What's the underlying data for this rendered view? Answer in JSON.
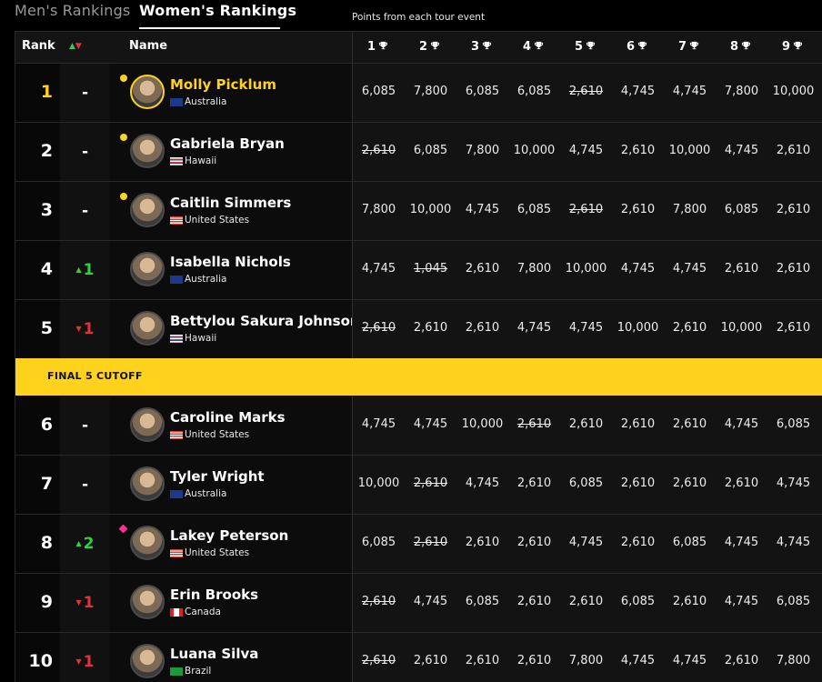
{
  "tabs": {
    "men": "Men's Rankings",
    "women": "Women's Rankings"
  },
  "caption": "Points from each tour event",
  "header": {
    "rank": "Rank",
    "name": "Name",
    "events": [
      "1",
      "2",
      "3",
      "4",
      "5",
      "6",
      "7",
      "8",
      "9"
    ]
  },
  "cutoff_label": "FINAL 5 CUTOFF",
  "colors": {
    "leader": "#ffd21e",
    "up": "#2fd33f",
    "down": "#e0323c",
    "cutoff_band": "#ffd21e"
  },
  "rows": [
    {
      "rank": "1",
      "move": "-",
      "move_dir": "none",
      "name": "Molly Picklum",
      "country": "Australia",
      "flag": "au",
      "leader": true,
      "marker": "yellow-dot",
      "scores": [
        "6,085",
        "7,800",
        "6,085",
        "6,085",
        "2,610",
        "4,745",
        "4,745",
        "7,800",
        "10,000"
      ],
      "dropped": [
        4
      ]
    },
    {
      "rank": "2",
      "move": "-",
      "move_dir": "none",
      "name": "Gabriela Bryan",
      "country": "Hawaii",
      "flag": "hi",
      "leader": false,
      "marker": "yellow-dot",
      "scores": [
        "2,610",
        "6,085",
        "7,800",
        "10,000",
        "4,745",
        "2,610",
        "10,000",
        "4,745",
        "2,610"
      ],
      "dropped": [
        0
      ]
    },
    {
      "rank": "3",
      "move": "-",
      "move_dir": "none",
      "name": "Caitlin Simmers",
      "country": "United States",
      "flag": "us",
      "leader": false,
      "marker": "yellow-dot",
      "scores": [
        "7,800",
        "10,000",
        "4,745",
        "6,085",
        "2,610",
        "2,610",
        "7,800",
        "6,085",
        "2,610"
      ],
      "dropped": [
        4
      ]
    },
    {
      "rank": "4",
      "move": "1",
      "move_dir": "up",
      "name": "Isabella Nichols",
      "country": "Australia",
      "flag": "au",
      "leader": false,
      "marker": "",
      "scores": [
        "4,745",
        "1,045",
        "2,610",
        "7,800",
        "10,000",
        "4,745",
        "4,745",
        "2,610",
        "2,610"
      ],
      "dropped": [
        1
      ]
    },
    {
      "rank": "5",
      "move": "1",
      "move_dir": "down",
      "name": "Bettylou Sakura Johnson",
      "country": "Hawaii",
      "flag": "hi",
      "leader": false,
      "marker": "",
      "scores": [
        "2,610",
        "2,610",
        "2,610",
        "4,745",
        "4,745",
        "10,000",
        "2,610",
        "10,000",
        "2,610"
      ],
      "dropped": [
        0
      ]
    },
    {
      "rank": "6",
      "move": "-",
      "move_dir": "none",
      "name": "Caroline Marks",
      "country": "United States",
      "flag": "us",
      "leader": false,
      "marker": "",
      "scores": [
        "4,745",
        "4,745",
        "10,000",
        "2,610",
        "2,610",
        "2,610",
        "2,610",
        "4,745",
        "6,085"
      ],
      "dropped": [
        3
      ]
    },
    {
      "rank": "7",
      "move": "-",
      "move_dir": "none",
      "name": "Tyler Wright",
      "country": "Australia",
      "flag": "au",
      "leader": false,
      "marker": "",
      "scores": [
        "10,000",
        "2,610",
        "4,745",
        "2,610",
        "6,085",
        "2,610",
        "2,610",
        "2,610",
        "4,745"
      ],
      "dropped": [
        1
      ]
    },
    {
      "rank": "8",
      "move": "2",
      "move_dir": "up",
      "name": "Lakey Peterson",
      "country": "United States",
      "flag": "us",
      "leader": false,
      "marker": "pink-diamond",
      "scores": [
        "6,085",
        "2,610",
        "2,610",
        "2,610",
        "4,745",
        "2,610",
        "6,085",
        "4,745",
        "4,745"
      ],
      "dropped": [
        1
      ]
    },
    {
      "rank": "9",
      "move": "1",
      "move_dir": "down",
      "name": "Erin Brooks",
      "country": "Canada",
      "flag": "ca",
      "leader": false,
      "marker": "",
      "scores": [
        "2,610",
        "4,745",
        "6,085",
        "2,610",
        "2,610",
        "6,085",
        "2,610",
        "4,745",
        "6,085"
      ],
      "dropped": [
        0
      ]
    },
    {
      "rank": "10",
      "move": "1",
      "move_dir": "down",
      "name": "Luana Silva",
      "country": "Brazil",
      "flag": "br",
      "leader": false,
      "marker": "",
      "scores": [
        "2,610",
        "2,610",
        "2,610",
        "2,610",
        "7,800",
        "4,745",
        "4,745",
        "2,610",
        "7,800"
      ],
      "dropped": [
        0
      ]
    }
  ]
}
